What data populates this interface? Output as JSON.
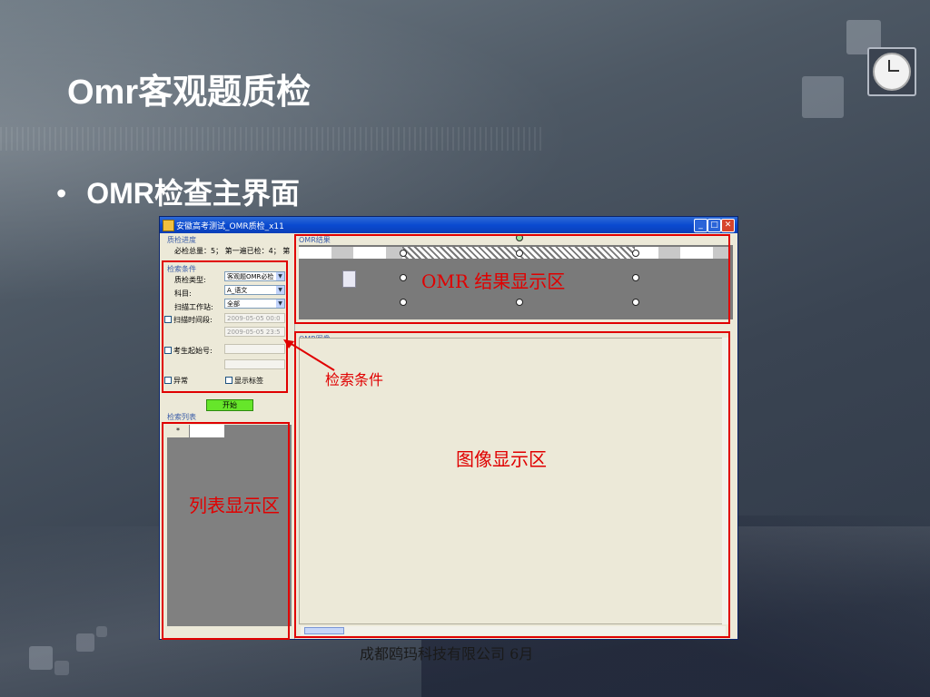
{
  "slide": {
    "title": "Omr客观题质检",
    "bullet": "OMR检查主界面",
    "bullet_symbol": "•",
    "footer": "成都鸥玛科技有限公司 6月"
  },
  "window": {
    "title": "安徽高考测试_OMR质检_x11",
    "buttons": {
      "minimize": "_",
      "maximize": "□",
      "close": "✕"
    },
    "progress": {
      "group_label": "质检进度",
      "text": "必检总量：5；  第一遍已检：4；  第"
    },
    "search": {
      "group_label": "检索条件",
      "type_label": "质检类型:",
      "type_value": "客观题OMR必检",
      "subject_label": "科目:",
      "subject_value": "A_语文",
      "station_label": "扫描工作站:",
      "station_value": "全部",
      "scan_time_label": "扫描时间段:",
      "scan_time_from": "2009-05-05 00:0",
      "scan_time_to": "2009-05-05 23:5",
      "exam_no_label": "考生起始号:",
      "exception_label": "异常",
      "show_tag_label": "显示标签",
      "start_button": "开始"
    },
    "list": {
      "group_label": "检索列表",
      "row_marker": "*"
    },
    "omr_result": {
      "group_label": "OMR结果"
    },
    "omr_image": {
      "group_label": "OMR图像"
    }
  },
  "annotations": {
    "result_area": "OMR 结果显示区",
    "search_conditions": "检索条件",
    "image_area": "图像显示区",
    "list_area": "列表显示区",
    "color": "#e00000"
  }
}
